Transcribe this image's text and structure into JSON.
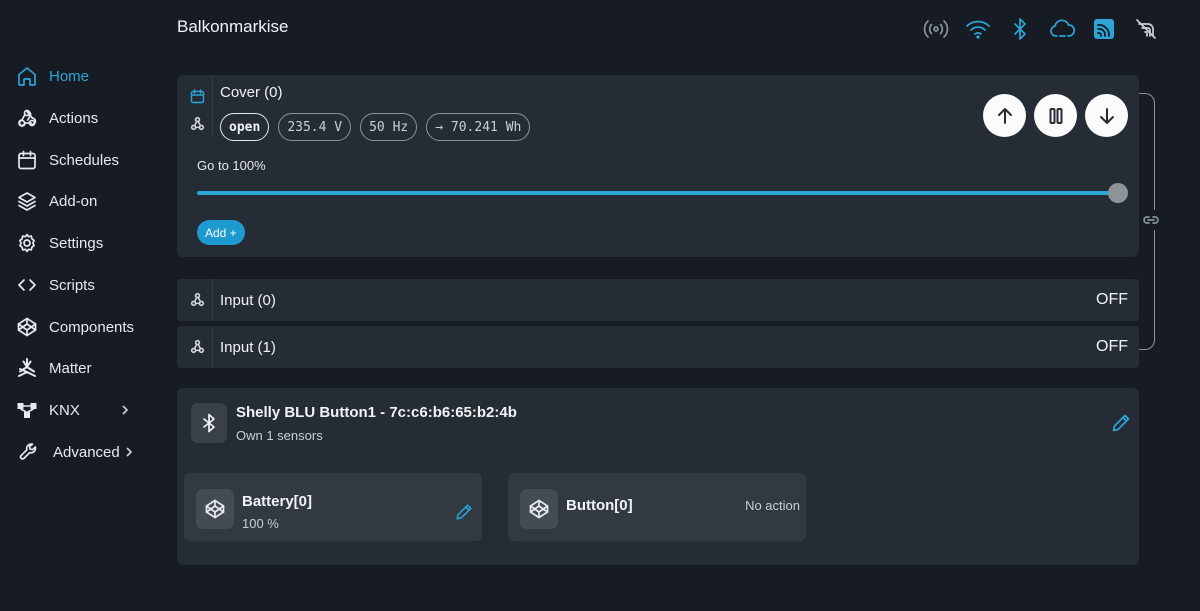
{
  "app": {
    "title": "Balkonmarkise"
  },
  "status_icons": [
    "broadcast-icon",
    "wifi-icon",
    "bluetooth-icon",
    "cloud-icon",
    "mqtt-icon",
    "signal-off-icon"
  ],
  "colors": {
    "accent": "#2aa5d6",
    "background": "#171c24",
    "card": "#262c35"
  },
  "sidebar": {
    "items": [
      {
        "label": "Home",
        "icon": "home-icon",
        "active": true
      },
      {
        "label": "Actions",
        "icon": "webhook-icon"
      },
      {
        "label": "Schedules",
        "icon": "calendar-icon"
      },
      {
        "label": "Add-on",
        "icon": "layers-icon"
      },
      {
        "label": "Settings",
        "icon": "gear-icon"
      },
      {
        "label": "Scripts",
        "icon": "code-icon"
      },
      {
        "label": "Components",
        "icon": "codepen-icon"
      },
      {
        "label": "Matter",
        "icon": "matter-icon"
      },
      {
        "label": "KNX",
        "icon": "knx-icon",
        "has_submenu": true
      },
      {
        "label": "Advanced",
        "icon": "wrench-icon",
        "has_submenu": true
      }
    ]
  },
  "cover": {
    "title": "Cover (0)",
    "state": "open",
    "voltage": "235.4 V",
    "frequency": "50 Hz",
    "energy": "→ 70.241 Wh",
    "goto_label": "Go to 100%",
    "position_percent": 100,
    "add_label": "Add +",
    "buttons": [
      "arrow-up-icon",
      "pause-icon",
      "arrow-down-icon"
    ]
  },
  "inputs": [
    {
      "label": "Input (0)",
      "state": "OFF"
    },
    {
      "label": "Input (1)",
      "state": "OFF"
    }
  ],
  "blu_device": {
    "title": "Shelly BLU Button1 - 7c:c6:b6:65:b2:4b",
    "subtitle": "Own 1 sensors",
    "sensors": [
      {
        "name": "Battery[0]",
        "value": "100 %"
      },
      {
        "name": "Button[0]",
        "action": "No action"
      }
    ]
  }
}
